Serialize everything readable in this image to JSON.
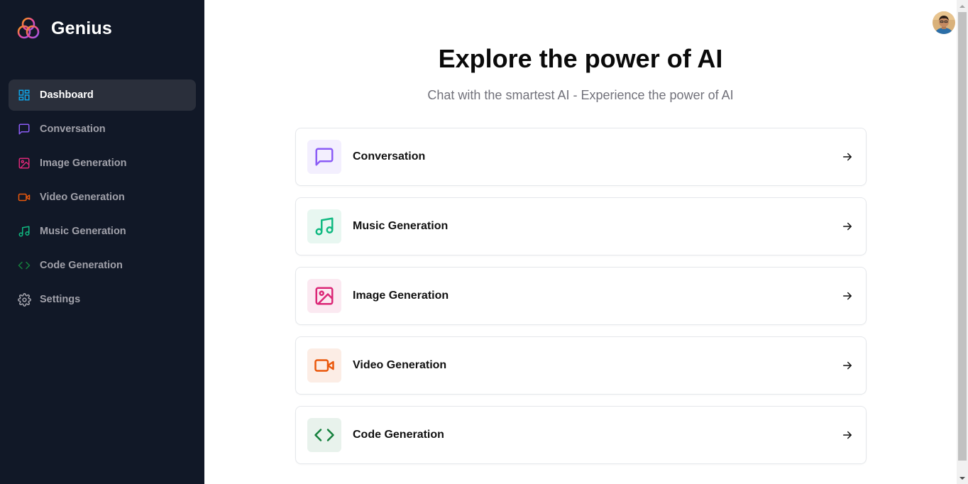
{
  "brand": {
    "name": "Genius",
    "logo_icon": "genius-logo-icon"
  },
  "sidebar": {
    "items": [
      {
        "label": "Dashboard",
        "icon": "dashboard-icon",
        "color": "#0ea5e9",
        "active": true
      },
      {
        "label": "Conversation",
        "icon": "message-square-icon",
        "color": "#8b5cf6",
        "active": false
      },
      {
        "label": "Image Generation",
        "icon": "image-icon",
        "color": "#db2777",
        "active": false
      },
      {
        "label": "Video Generation",
        "icon": "video-icon",
        "color": "#ea580c",
        "active": false
      },
      {
        "label": "Music Generation",
        "icon": "music-icon",
        "color": "#10b981",
        "active": false
      },
      {
        "label": "Code Generation",
        "icon": "code-icon",
        "color": "#15803d",
        "active": false
      },
      {
        "label": "Settings",
        "icon": "settings-icon",
        "color": "#a1a1aa",
        "active": false
      }
    ]
  },
  "header": {
    "avatar_icon": "user-avatar"
  },
  "main": {
    "title": "Explore the power of AI",
    "subtitle": "Chat with the smartest AI - Experience the power of AI",
    "tools": [
      {
        "label": "Conversation",
        "icon": "message-square-icon",
        "color": "#8b5cf6",
        "bg": "#f3effe"
      },
      {
        "label": "Music Generation",
        "icon": "music-icon",
        "color": "#10b981",
        "bg": "#e8f7f1"
      },
      {
        "label": "Image Generation",
        "icon": "image-icon",
        "color": "#db2777",
        "bg": "#fbe9f1"
      },
      {
        "label": "Video Generation",
        "icon": "video-icon",
        "color": "#ea580c",
        "bg": "#fcede5"
      },
      {
        "label": "Code Generation",
        "icon": "code-icon",
        "color": "#15803d",
        "bg": "#e8f2ec"
      }
    ]
  },
  "colors": {
    "sidebar_bg": "#111827",
    "active_bg": "#2a2f3b",
    "text_muted": "#a1a1aa"
  }
}
